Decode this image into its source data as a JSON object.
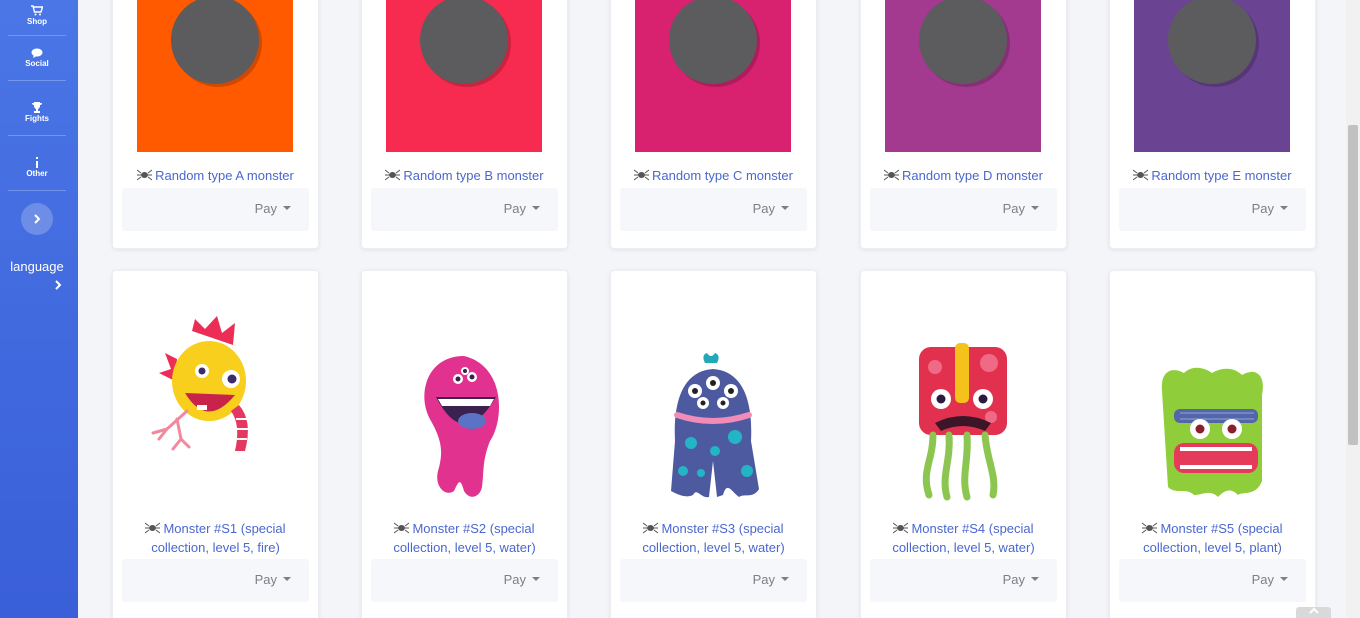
{
  "sidebar": {
    "items": [
      {
        "label": "Shop",
        "icon": "cart-icon"
      },
      {
        "label": "Social",
        "icon": "chat-icon"
      },
      {
        "label": "Fights",
        "icon": "trophy-icon"
      },
      {
        "label": "Other",
        "icon": "info-icon"
      }
    ],
    "language_label": "language"
  },
  "colors": {
    "sidebar": "#4a76e6",
    "link": "#4a67cf",
    "placeholder_A": "#ff5a00",
    "placeholder_B": "#f72b4f",
    "placeholder_C": "#d8226f",
    "placeholder_D": "#a33a8f",
    "placeholder_E": "#6b4393"
  },
  "random_cards": [
    {
      "title": "Random type A monster",
      "pay_label": "Pay",
      "color": "#ff5a00"
    },
    {
      "title": "Random type B monster",
      "pay_label": "Pay",
      "color": "#f72b4f"
    },
    {
      "title": "Random type C monster",
      "pay_label": "Pay",
      "color": "#d8226f"
    },
    {
      "title": "Random type D monster",
      "pay_label": "Pay",
      "color": "#a33a8f"
    },
    {
      "title": "Random type E monster",
      "pay_label": "Pay",
      "color": "#6b4393"
    }
  ],
  "monster_cards": [
    {
      "title_line1": "Monster #S1 (special",
      "title_line2": "collection, level 5, fire)",
      "pay_label": "Pay"
    },
    {
      "title_line1": "Monster #S2 (special",
      "title_line2": "collection, level 5, water)",
      "pay_label": "Pay"
    },
    {
      "title_line1": "Monster #S3 (special",
      "title_line2": "collection, level 5, water)",
      "pay_label": "Pay"
    },
    {
      "title_line1": "Monster #S4 (special",
      "title_line2": "collection, level 5, water)",
      "pay_label": "Pay"
    },
    {
      "title_line1": "Monster #S5 (special",
      "title_line2": "collection, level 5, plant)",
      "pay_label": "Pay"
    }
  ]
}
